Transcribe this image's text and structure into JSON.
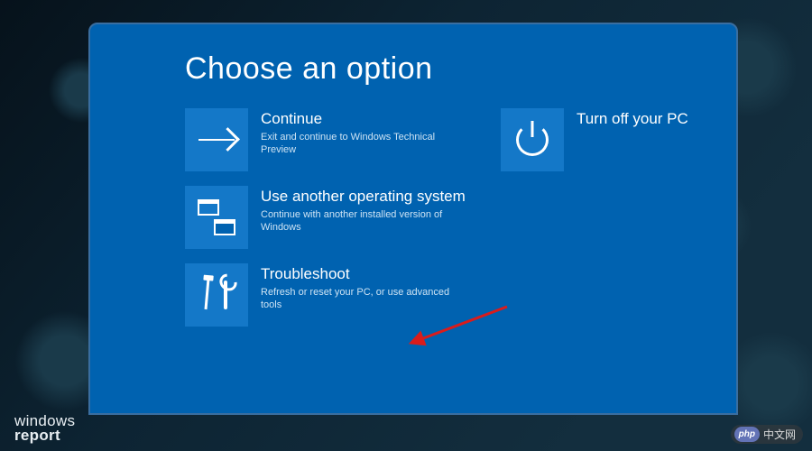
{
  "screen": {
    "title": "Choose an option",
    "tiles": [
      {
        "id": "continue",
        "title": "Continue",
        "desc": "Exit and continue to Windows Technical Preview",
        "icon": "arrow-right-icon"
      },
      {
        "id": "turnoff",
        "title": "Turn off your PC",
        "desc": "",
        "icon": "power-icon"
      },
      {
        "id": "useanother",
        "title": "Use another operating system",
        "desc": "Continue with another installed version of Windows",
        "icon": "windows-stack-icon"
      },
      {
        "id": "troubleshoot",
        "title": "Troubleshoot",
        "desc": "Refresh or reset your PC, or use advanced tools",
        "icon": "tools-icon"
      }
    ]
  },
  "annotation": {
    "type": "red-arrow",
    "points_to": "troubleshoot"
  },
  "watermarks": {
    "left_line1": "windows",
    "left_line2": "report",
    "right_badge": "php",
    "right_text": "中文网"
  },
  "colors": {
    "panel_bg": "#0062b0",
    "tile_bg": "#1478c8",
    "arrow": "#d91c1c"
  }
}
